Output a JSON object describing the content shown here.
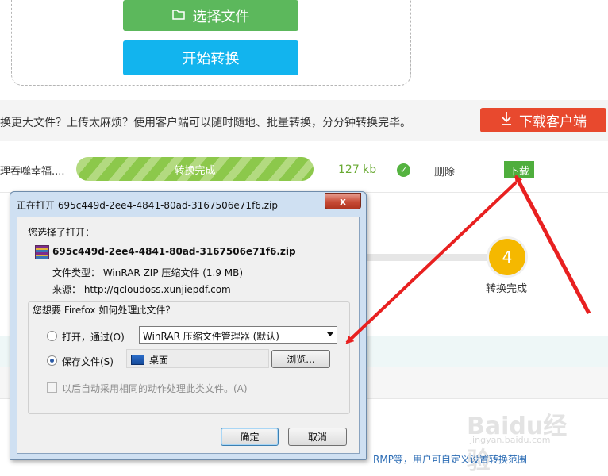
{
  "page": {
    "select_file_label": "选择文件",
    "start_convert_label": "开始转换",
    "promo_text": "换更大文件？上传太麻烦？使用客户端可以随时随地、批量转换，分分钟转换完毕。",
    "download_client_label": "下载客户端",
    "file_row": {
      "name": "理吞噬幸福....",
      "progress_label": "转换完成",
      "progress_fraction": 1.0,
      "size": "127 kb",
      "delete_label": "删除",
      "download_label": "下载"
    },
    "step": {
      "number": "4",
      "label": "转换完成"
    },
    "bottom_text": "RMP等，用户可自定义设置转换范围",
    "watermark": "Baidu经验",
    "watermark_sub": "jingyan.baidu.com"
  },
  "dialog": {
    "title": "正在打开 695c449d-2ee4-4841-80ad-3167506e71f6.zip",
    "close_label": "x",
    "you_chose": "您选择了打开：",
    "file_name": "695c449d-2ee4-4841-80ad-3167506e71f6.zip",
    "file_type": "文件类型：  WinRAR ZIP 压缩文件 (1.9 MB)",
    "source": "来源：  http://qcloudoss.xunjiepdf.com",
    "question": "您想要 Firefox 如何处理此文件？",
    "open_with_label": "打开，通过(O)",
    "open_with_app": "WinRAR 压缩文件管理器 (默认)",
    "save_file_label": "保存文件(S)",
    "save_location": "桌面",
    "browse_label": "浏览...",
    "auto_label": "以后自动采用相同的动作处理此类文件。(A)",
    "ok_label": "确定",
    "cancel_label": "取消"
  },
  "colors": {
    "green": "#5cb85c",
    "blue": "#12b4ee",
    "red": "#e8492e",
    "arrow_red": "#e82020"
  }
}
